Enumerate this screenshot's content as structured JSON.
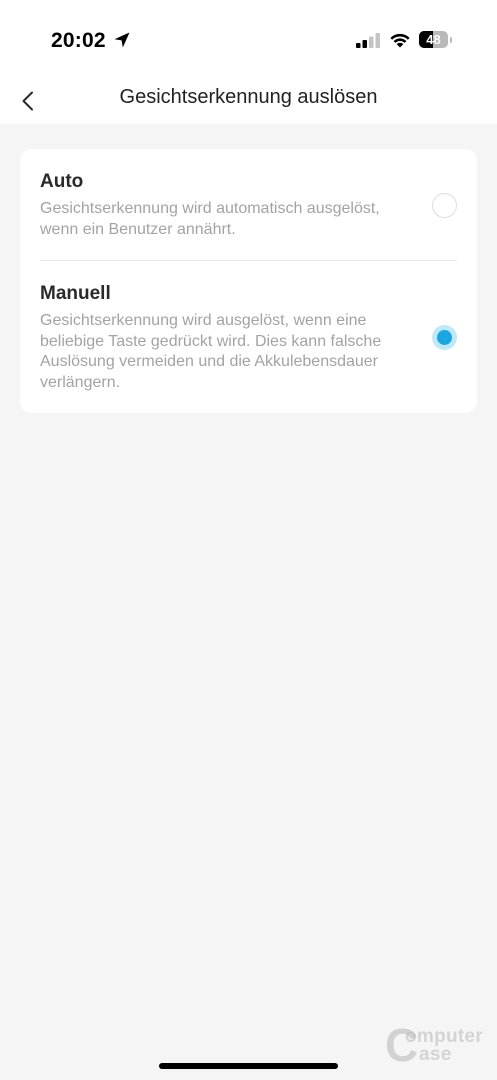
{
  "status_bar": {
    "time": "20:02",
    "battery_level": "48",
    "battery_fraction": 0.48,
    "icons": [
      "location-arrow-icon",
      "cellular-signal-icon",
      "wifi-icon",
      "battery-icon"
    ]
  },
  "header": {
    "title": "Gesichtserkennung auslösen",
    "back_icon": "chevron-left-icon"
  },
  "options": [
    {
      "title": "Auto",
      "description": "Gesichtserkennung wird automatisch ausgelöst, wenn ein Benutzer annährt.",
      "selected": false
    },
    {
      "title": "Manuell",
      "description": "Gesichtserkennung wird ausgelöst, wenn eine beliebige Taste gedrückt wird. Dies kann falsche Auslösung vermeiden und die Akkulebensdauer verlängern.",
      "selected": true
    }
  ],
  "colors": {
    "accent": "#1aa6e2",
    "accent_halo": "#bfe9f8",
    "background": "#f5f5f5",
    "card": "#ffffff",
    "description_text": "#a3a3a3"
  },
  "watermark": {
    "top": "omputer",
    "bottom": "ase",
    "letter": "C"
  }
}
